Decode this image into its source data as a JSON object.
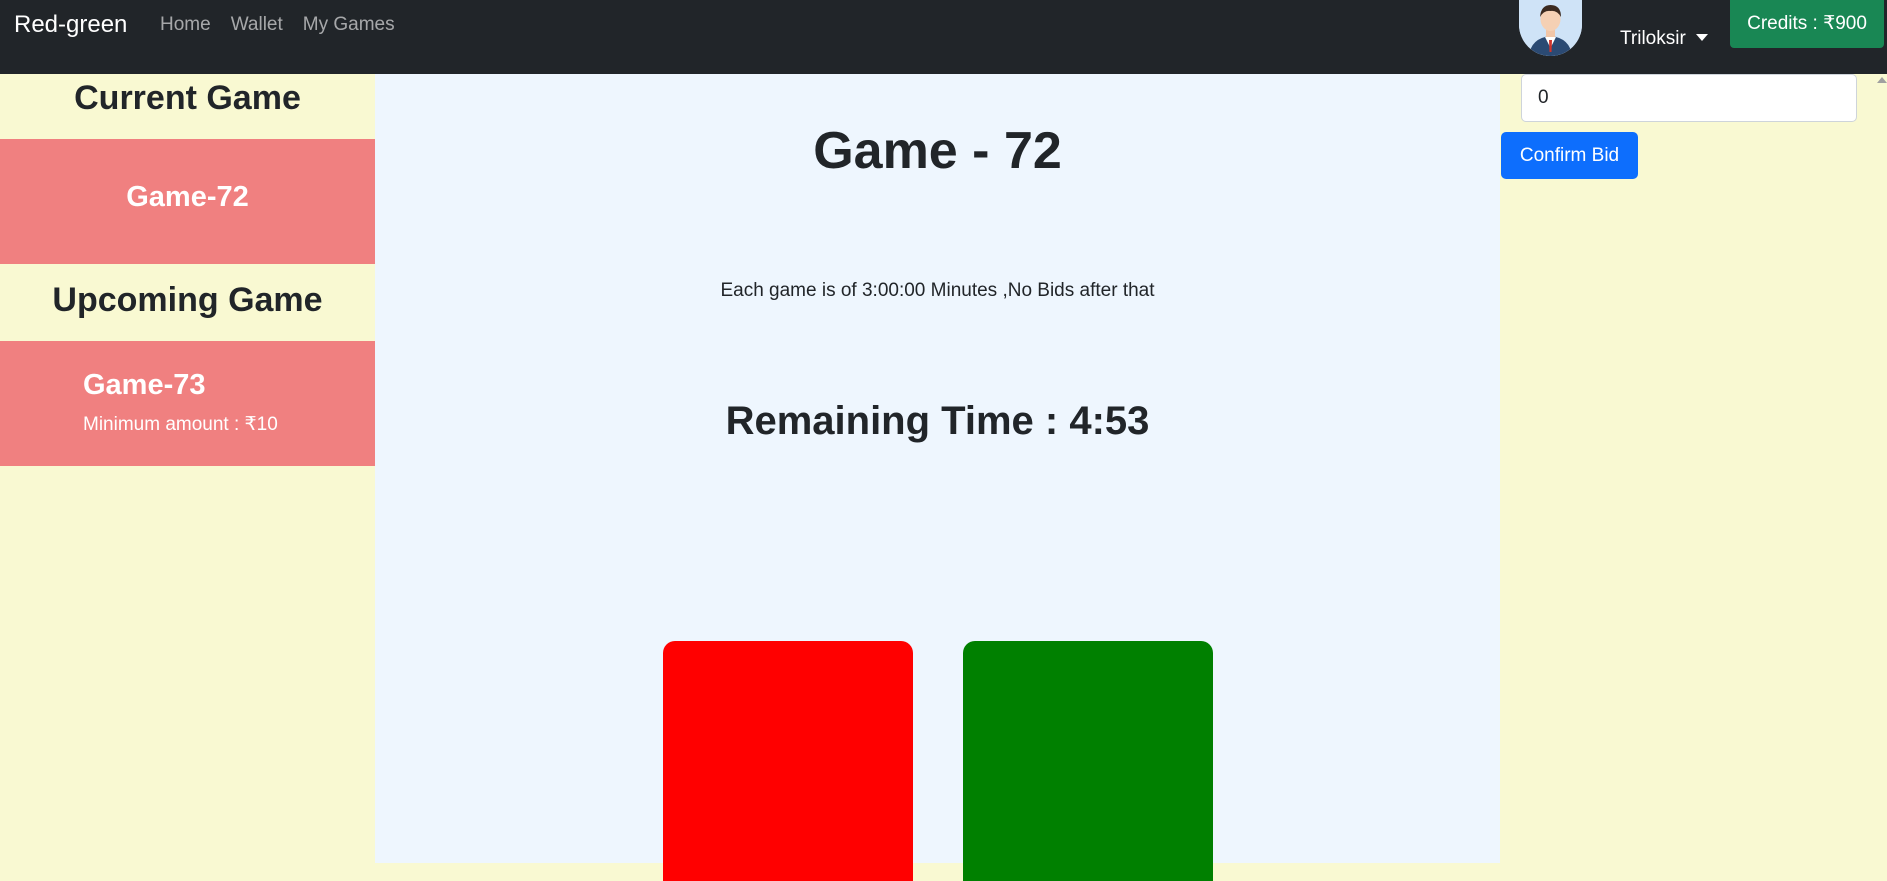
{
  "navbar": {
    "brand": "Red-green",
    "links": [
      "Home",
      "Wallet",
      "My Games"
    ],
    "username": "Triloksir",
    "credits": "Credits : ₹900"
  },
  "sidebar": {
    "current_heading": "Current Game",
    "current_game": "Game-72",
    "upcoming_heading": "Upcoming Game",
    "upcoming_game": "Game-73",
    "upcoming_min": "Minimum amount : ₹10"
  },
  "main": {
    "title": "Game - 72",
    "info": "Each game is of 3:00:00 Minutes ,No Bids after that",
    "remaining": "Remaining Time : 4:53",
    "colors": {
      "red": "#ff0000",
      "green": "#008000"
    }
  },
  "bid": {
    "value": "0",
    "confirm_label": "Confirm Bid"
  }
}
